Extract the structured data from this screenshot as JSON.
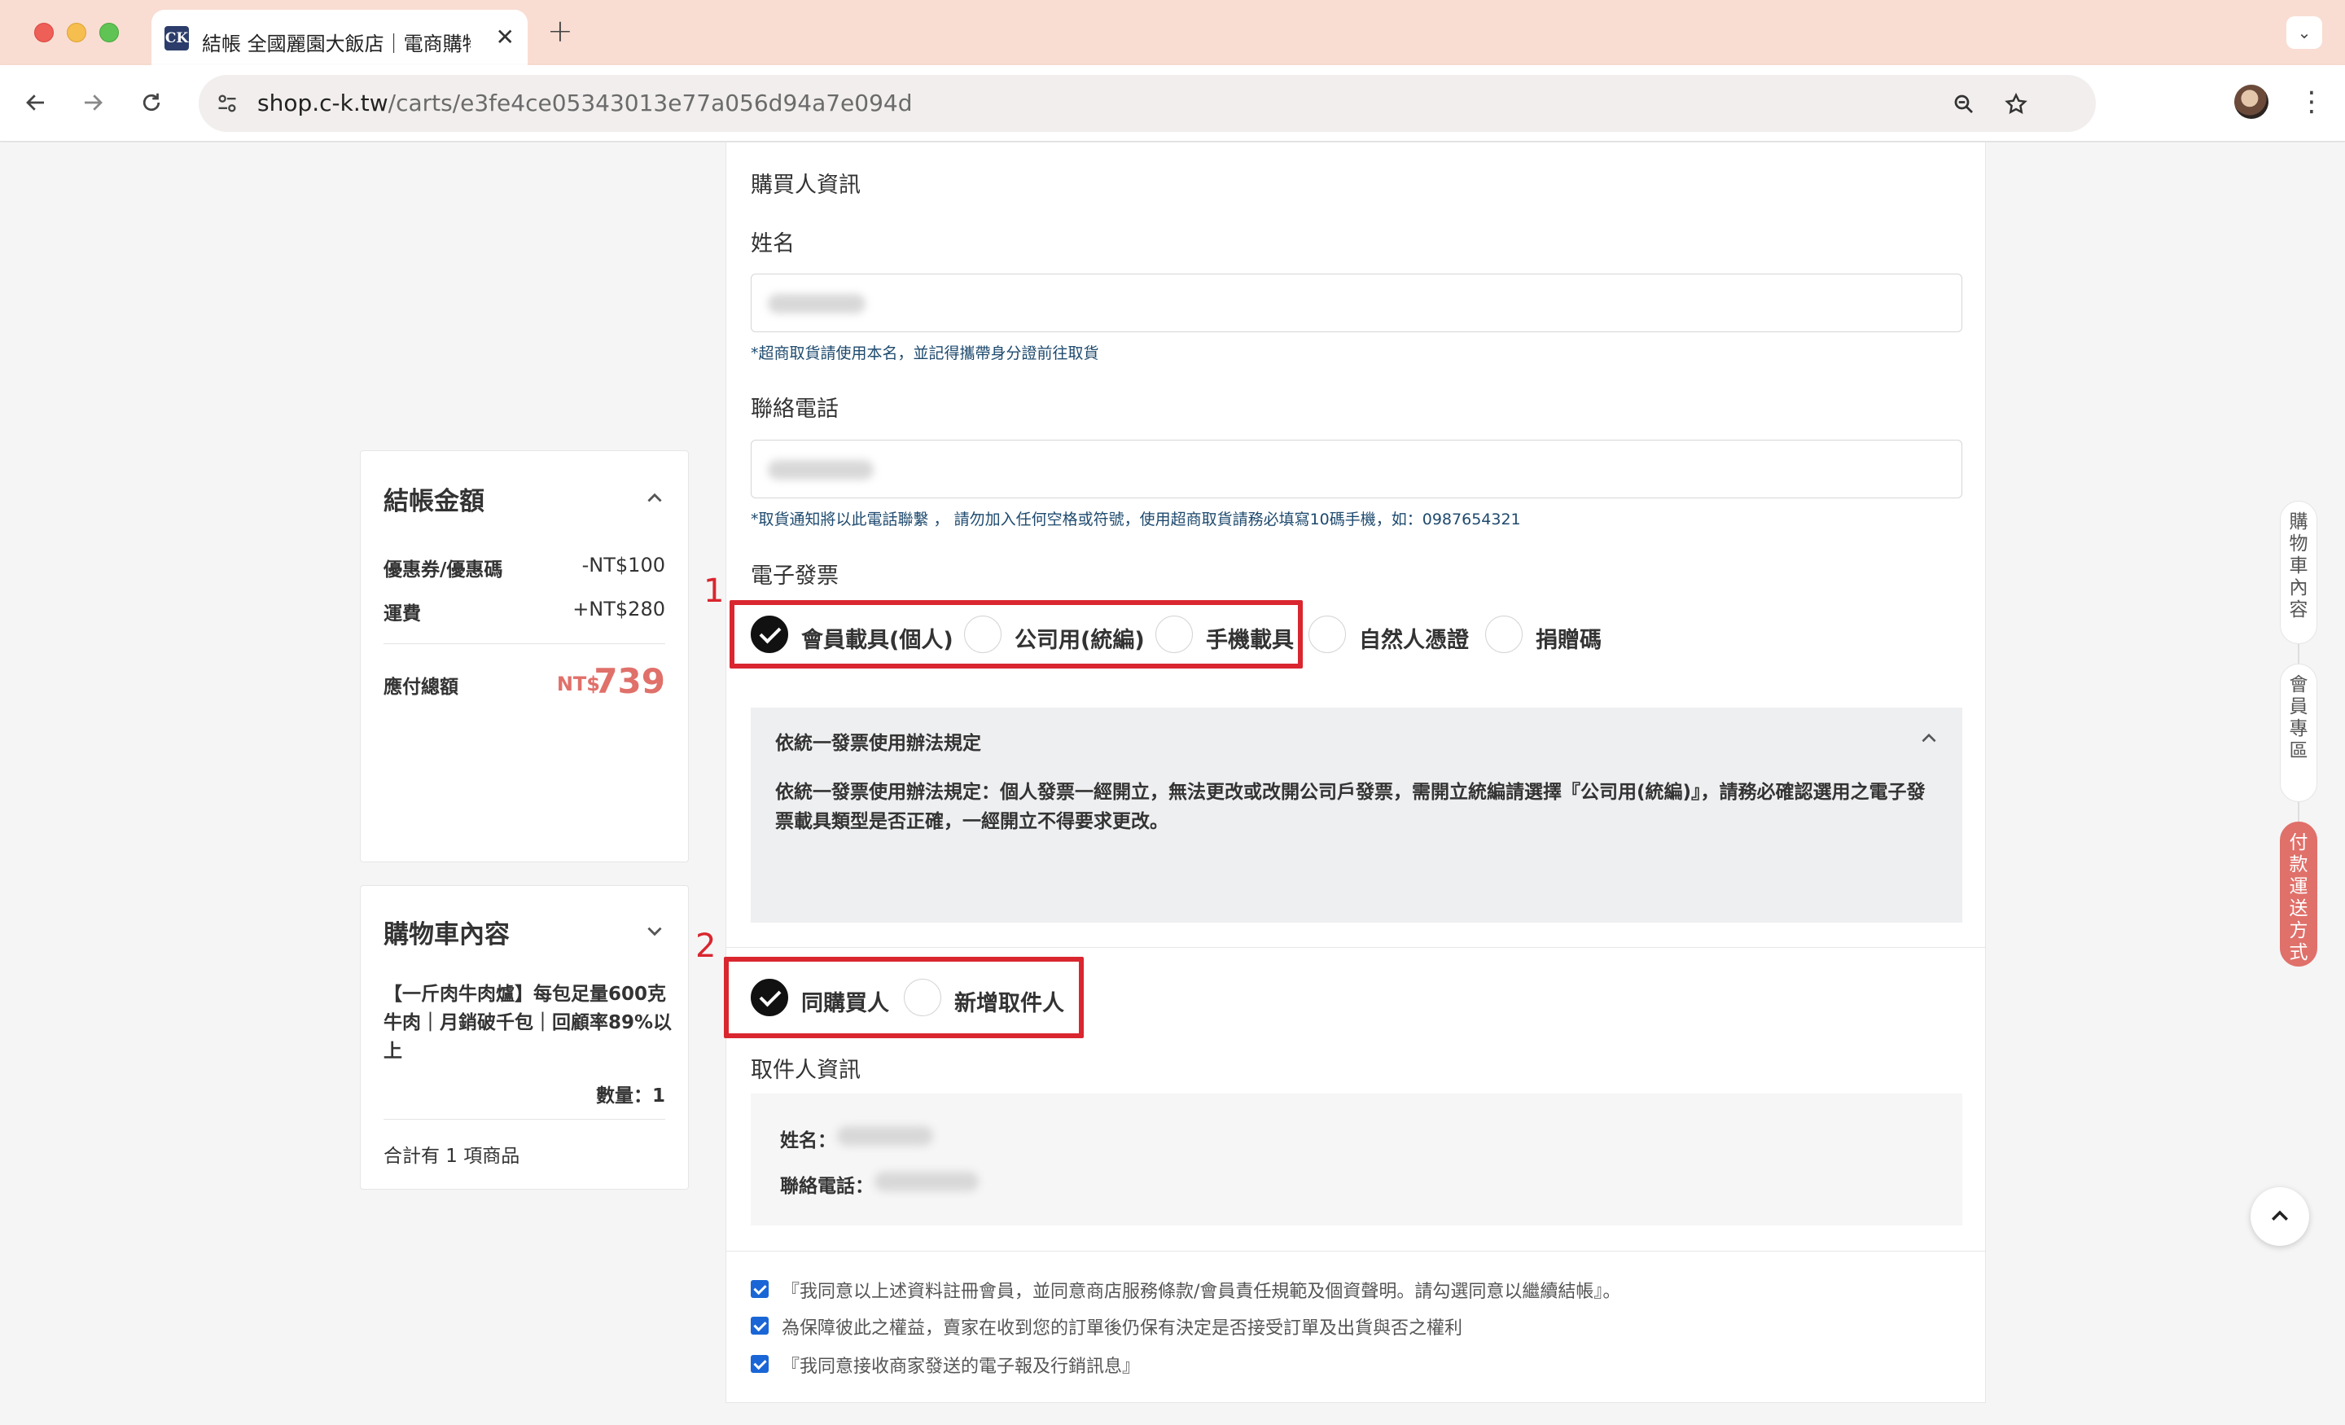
{
  "browser": {
    "tab_title": "結帳 全國麗園大飯店｜電商購物",
    "favicon_text": "CK",
    "tab_close": "✕",
    "new_tab": "+",
    "tab_menu": "⌄",
    "url_host": "shop.c-k.tw",
    "url_path": "/carts/e3fe4ce05343013e77a056d94a7e094d"
  },
  "order_summary": {
    "title": "結帳金額",
    "coupon_label": "優惠券/優惠碼",
    "coupon_value": "-NT$100",
    "shipping_label": "運費",
    "shipping_value": "+NT$280",
    "total_label": "應付總額",
    "total_currency": "NT$",
    "total_value": "739"
  },
  "cart": {
    "title": "購物車內容",
    "item_name": "【一斤肉牛肉爐】每包足量600克牛肉｜月銷破千包｜回顧率89%以上",
    "quantity": "數量：1",
    "count_text": "合計有 1 項商品"
  },
  "buyer": {
    "section_title": "購買人資訊",
    "name_label": "姓名",
    "name_hint": "*超商取貨請使用本名，並記得攜帶身分證前往取貨",
    "phone_label": "聯絡電話",
    "phone_hint": "*取貨通知將以此電話聯繫 ， 請勿加入任何空格或符號，使用超商取貨請務必填寫10碼手機，如：0987654321"
  },
  "invoice": {
    "label": "電子發票",
    "step_number": "1",
    "options": [
      {
        "label": "會員載具(個人)",
        "selected": true
      },
      {
        "label": "公司用(統編)",
        "selected": false
      },
      {
        "label": "手機載具",
        "selected": false
      },
      {
        "label": "自然人憑證",
        "selected": false
      },
      {
        "label": "捐贈碼",
        "selected": false
      }
    ],
    "notice_title": "依統一發票使用辦法規定",
    "notice_body": "依統一發票使用辦法規定：個人發票一經開立，無法更改或改開公司戶發票，需開立統編請選擇『公司用(統編)』，請務必確認選用之電子發票載具類型是否正確，一經開立不得要求更改。"
  },
  "receiver": {
    "step_number": "2",
    "options": [
      {
        "label": "同購買人",
        "selected": true
      },
      {
        "label": "新增取件人",
        "selected": false
      }
    ],
    "section_title": "取件人資訊",
    "name_label": "姓名：",
    "phone_label": "聯絡電話："
  },
  "agreements": [
    {
      "text": "『我同意以上述資料註冊會員，並同意商店服務條款/會員責任規範及個資聲明。請勾選同意以繼續結帳』。",
      "checked": true
    },
    {
      "text": "為保障彼此之權益，賣家在收到您的訂單後仍保有決定是否接受訂單及出貨與否之權利",
      "checked": true
    },
    {
      "text": "『我同意接收商家發送的電子報及行銷訊息』",
      "checked": true
    }
  ],
  "side_nav": {
    "cart": "購物車內容",
    "member": "會員專區",
    "payment": "付款運送方式"
  },
  "colors": {
    "accent": "#e0706a",
    "highlight_box": "#d9262f",
    "checkbox": "#1a66d6",
    "hint_text": "#1e4a6e"
  }
}
